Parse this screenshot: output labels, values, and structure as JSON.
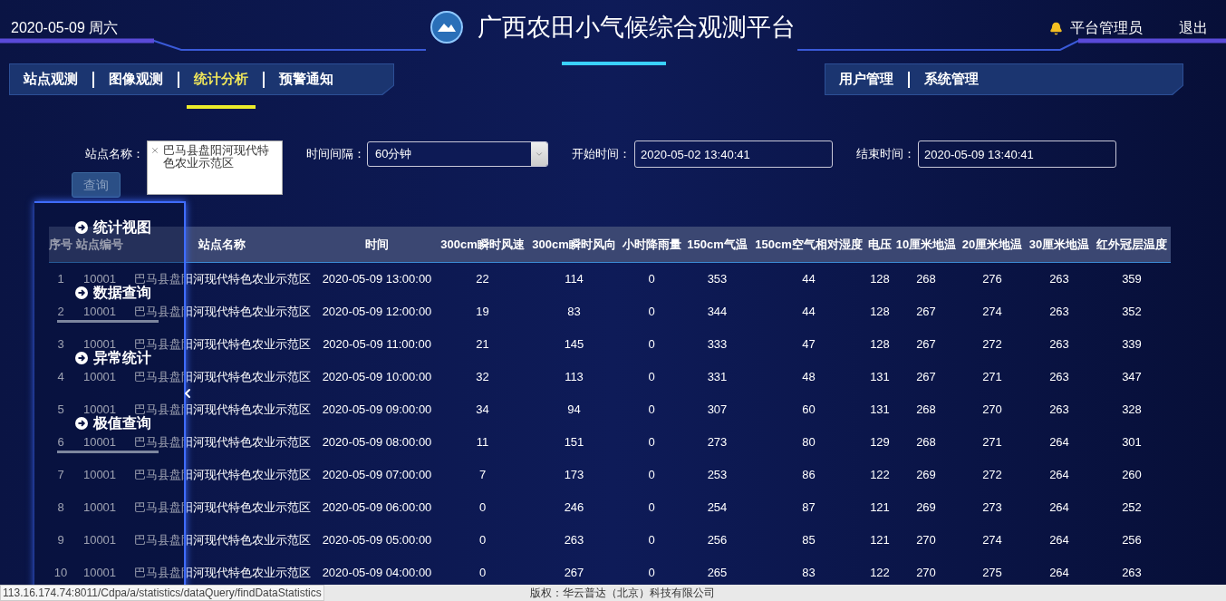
{
  "header": {
    "date": "2020-05-09 周六",
    "title": "广西农田小气候综合观测平台",
    "user": "平台管理员",
    "logout": "退出"
  },
  "nav_left": [
    {
      "label": "站点观测",
      "selected": false
    },
    {
      "label": "图像观测",
      "selected": false
    },
    {
      "label": "统计分析",
      "selected": true
    },
    {
      "label": "预警通知",
      "selected": false
    }
  ],
  "nav_right": [
    {
      "label": "用户管理",
      "selected": false
    },
    {
      "label": "系统管理",
      "selected": false
    }
  ],
  "filters": {
    "station": {
      "label": "站点名称：",
      "tag": "巴马县盘阳河现代特色农业示范区"
    },
    "interval": {
      "label": "时间间隔：",
      "value": "60分钟"
    },
    "start": {
      "label": "开始时间：",
      "value": "2020-05-02 13:40:41"
    },
    "end": {
      "label": "结束时间：",
      "value": "2020-05-09 13:40:41"
    }
  },
  "query_button": "查询",
  "side_menu": [
    {
      "label": "统计视图",
      "underlined": false
    },
    {
      "label": "数据查询",
      "underlined": true
    },
    {
      "label": "异常统计",
      "underlined": false
    },
    {
      "label": "极值查询",
      "underlined": true
    }
  ],
  "table": {
    "columns": [
      "序号",
      "站点编号",
      "站点名称",
      "时间",
      "300cm瞬时风速",
      "300cm瞬时风向",
      "小时降雨量",
      "150cm气温",
      "150cm空气相对湿度",
      "电压",
      "10厘米地温",
      "20厘米地温",
      "30厘米地温",
      "红外冠层温度"
    ],
    "rows": [
      [
        "1",
        "10001",
        "巴马县盘阳河现代特色农业示范区",
        "2020-05-09 13:00:00",
        "22",
        "114",
        "0",
        "353",
        "44",
        "128",
        "268",
        "276",
        "263",
        "359"
      ],
      [
        "2",
        "10001",
        "巴马县盘阳河现代特色农业示范区",
        "2020-05-09 12:00:00",
        "19",
        "83",
        "0",
        "344",
        "44",
        "128",
        "267",
        "274",
        "263",
        "352"
      ],
      [
        "3",
        "10001",
        "巴马县盘阳河现代特色农业示范区",
        "2020-05-09 11:00:00",
        "21",
        "145",
        "0",
        "333",
        "47",
        "128",
        "267",
        "272",
        "263",
        "339"
      ],
      [
        "4",
        "10001",
        "巴马县盘阳河现代特色农业示范区",
        "2020-05-09 10:00:00",
        "32",
        "113",
        "0",
        "331",
        "48",
        "131",
        "267",
        "271",
        "263",
        "347"
      ],
      [
        "5",
        "10001",
        "巴马县盘阳河现代特色农业示范区",
        "2020-05-09 09:00:00",
        "34",
        "94",
        "0",
        "307",
        "60",
        "131",
        "268",
        "270",
        "263",
        "328"
      ],
      [
        "6",
        "10001",
        "巴马县盘阳河现代特色农业示范区",
        "2020-05-09 08:00:00",
        "11",
        "151",
        "0",
        "273",
        "80",
        "129",
        "268",
        "271",
        "264",
        "301"
      ],
      [
        "7",
        "10001",
        "巴马县盘阳河现代特色农业示范区",
        "2020-05-09 07:00:00",
        "7",
        "173",
        "0",
        "253",
        "86",
        "122",
        "269",
        "272",
        "264",
        "260"
      ],
      [
        "8",
        "10001",
        "巴马县盘阳河现代特色农业示范区",
        "2020-05-09 06:00:00",
        "0",
        "246",
        "0",
        "254",
        "87",
        "121",
        "269",
        "273",
        "264",
        "252"
      ],
      [
        "9",
        "10001",
        "巴马县盘阳河现代特色农业示范区",
        "2020-05-09 05:00:00",
        "0",
        "263",
        "0",
        "256",
        "85",
        "121",
        "270",
        "274",
        "264",
        "256"
      ],
      [
        "10",
        "10001",
        "巴马县盘阳河现代特色农业示范区",
        "2020-05-09 04:00:00",
        "0",
        "267",
        "0",
        "265",
        "83",
        "122",
        "270",
        "275",
        "264",
        "263"
      ]
    ]
  },
  "status_bar": {
    "url": "113.16.174.74:8011/Cdpa/a/statistics/dataQuery/findDataStatistics",
    "copyright": "版权：华云普达（北京）科技有限公司"
  }
}
